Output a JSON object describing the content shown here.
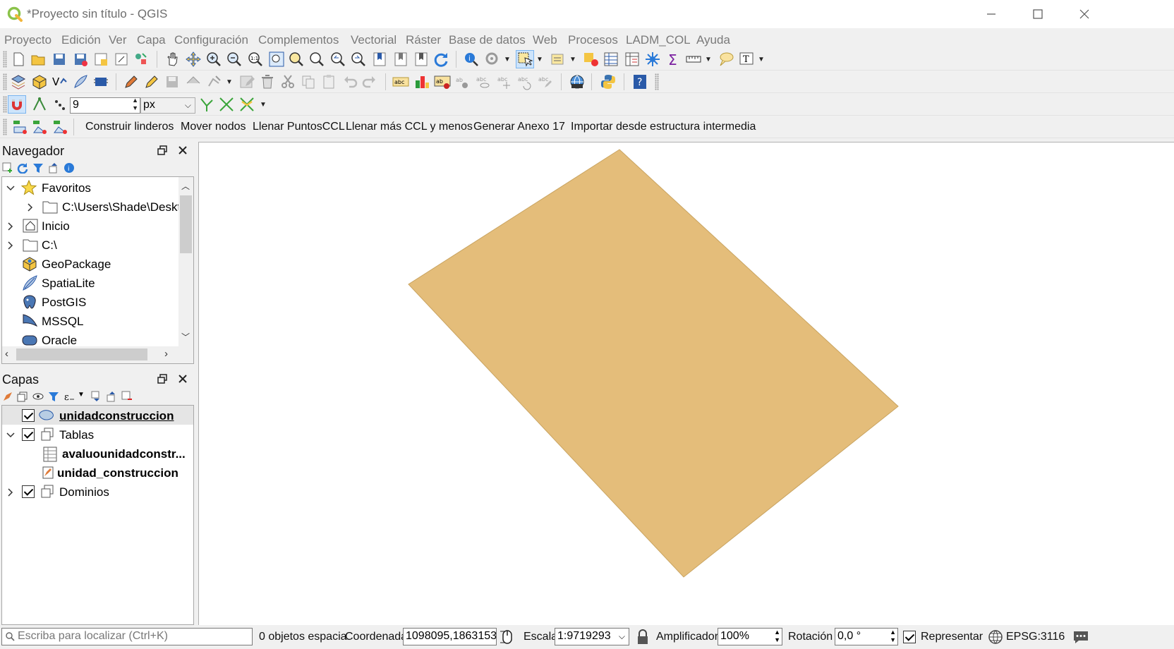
{
  "window": {
    "title": "*Proyecto sin título - QGIS"
  },
  "menubar": {
    "items": [
      "Proyecto",
      "Edición",
      "Ver",
      "Capa",
      "Configuración",
      "Complementos",
      "Vectorial",
      "Ráster",
      "Base de datos",
      "Web",
      "Procesos",
      "LADM_COL",
      "Ayuda"
    ]
  },
  "snapping": {
    "tolerance": "9",
    "unit": "px"
  },
  "plugin_toolbar": {
    "buttons": [
      "Construir linderos",
      "Mover nodos",
      "Llenar PuntosCCL",
      "Llenar más CCL y menos",
      "Generar Anexo 17",
      "Importar desde estructura intermedia"
    ]
  },
  "browser_panel": {
    "title": "Navegador",
    "items": [
      {
        "label": "Favoritos",
        "icon": "star-icon",
        "expanded": true
      },
      {
        "label": "C:\\Users\\Shade\\Deskt",
        "icon": "folder-icon",
        "expanded": false
      },
      {
        "label": "Inicio",
        "icon": "home-icon",
        "expanded": false
      },
      {
        "label": "C:\\",
        "icon": "folder-icon",
        "expanded": false
      },
      {
        "label": "GeoPackage",
        "icon": "geopackage-icon"
      },
      {
        "label": "SpatiaLite",
        "icon": "spatialite-icon"
      },
      {
        "label": "PostGIS",
        "icon": "postgis-icon"
      },
      {
        "label": "MSSQL",
        "icon": "mssql-icon"
      },
      {
        "label": "Oracle",
        "icon": "oracle-icon"
      }
    ]
  },
  "layers_panel": {
    "title": "Capas",
    "items": [
      {
        "label": "unidadconstruccion",
        "checked": true,
        "type": "polygon-layer"
      },
      {
        "label": "Tablas",
        "checked": true,
        "type": "group"
      },
      {
        "label": "avaluounidadconstr...",
        "type": "table"
      },
      {
        "label": "unidad_construccion",
        "type": "table"
      },
      {
        "label": "Dominios",
        "checked": true,
        "type": "group"
      }
    ]
  },
  "map": {
    "polygon_fill": "#e4bd7a",
    "polygon_stroke": "#c9a461",
    "background": "#ffffff"
  },
  "statusbar": {
    "locator_placeholder": "Escriba para localizar (Ctrl+K)",
    "selection_text": "0 objetos espacia",
    "coord_label": "Coordenada",
    "coord_value": "1098095,1863153",
    "scale_label": "Escala",
    "scale_value": "1:9719293",
    "magnifier_label": "Amplificador",
    "magnifier_value": "100%",
    "rotation_label": "Rotación",
    "rotation_value": "0,0 °",
    "render_label": "Representar",
    "crs": "EPSG:3116"
  }
}
